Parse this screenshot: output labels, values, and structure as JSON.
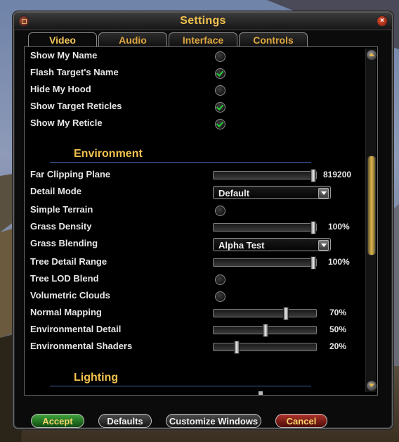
{
  "window": {
    "title": "Settings"
  },
  "tabs": [
    {
      "label": "Video",
      "active": true
    },
    {
      "label": "Audio",
      "active": false
    },
    {
      "label": "Interface",
      "active": false
    },
    {
      "label": "Controls",
      "active": false
    }
  ],
  "settings": {
    "show_my_name": {
      "label": "Show My Name",
      "checked": false
    },
    "flash_target_name": {
      "label": "Flash Target's Name",
      "checked": true
    },
    "hide_my_hood": {
      "label": "Hide My Hood",
      "checked": false
    },
    "show_target_reticles": {
      "label": "Show Target Reticles",
      "checked": true
    },
    "show_my_reticle": {
      "label": "Show My Reticle",
      "checked": true
    }
  },
  "environment": {
    "heading": "Environment",
    "far_clipping_plane": {
      "label": "Far Clipping Plane",
      "value_text": "819200",
      "level": 1.0
    },
    "detail_mode": {
      "label": "Detail Mode",
      "value": "Default"
    },
    "simple_terrain": {
      "label": "Simple Terrain",
      "checked": false
    },
    "grass_density": {
      "label": "Grass Density",
      "value_text": "100%",
      "level": 1.0
    },
    "grass_blending": {
      "label": "Grass Blending",
      "value": "Alpha Test"
    },
    "tree_detail_range": {
      "label": "Tree Detail Range",
      "value_text": "100%",
      "level": 1.0
    },
    "tree_lod_blend": {
      "label": "Tree LOD Blend",
      "checked": false
    },
    "volumetric_clouds": {
      "label": "Volumetric Clouds",
      "checked": false
    },
    "normal_mapping": {
      "label": "Normal Mapping",
      "value_text": "70%",
      "level": 0.7
    },
    "environmental_detail": {
      "label": "Environmental Detail",
      "value_text": "50%",
      "level": 0.5
    },
    "environmental_shaders": {
      "label": "Environmental Shaders",
      "value_text": "20%",
      "level": 0.2
    }
  },
  "lighting": {
    "heading": "Lighting"
  },
  "buttons": {
    "accept": "Accept",
    "defaults": "Defaults",
    "customize": "Customize Windows",
    "cancel": "Cancel"
  },
  "colors": {
    "accent": "#f2c14e",
    "check": "#27d23a",
    "rule": "#3f63a8"
  }
}
